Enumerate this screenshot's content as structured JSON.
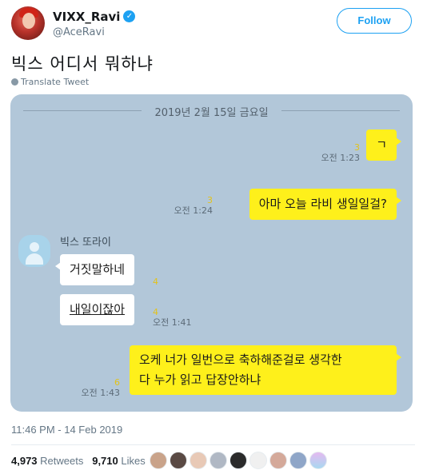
{
  "user": {
    "display_name": "VIXX_Ravi",
    "handle": "@AceRavi",
    "follow_label": "Follow"
  },
  "tweet": {
    "text": "빅스 어디서 뭐하냐",
    "translate_label": "Translate Tweet",
    "timestamp": "11:46 PM - 14 Feb 2019"
  },
  "chat": {
    "date_separator": "2019년 2월 15일 금요일",
    "friend_name": "빅스 또라이",
    "messages": [
      {
        "from": "me",
        "text": "ㄱ",
        "count": "3",
        "time": "오전 1:23"
      },
      {
        "from": "me",
        "text": "아마 오늘 라비 생일일걸?",
        "count": "3",
        "time": "오전 1:24"
      },
      {
        "from": "them",
        "text": "거짓말하네",
        "count": "4",
        "time": ""
      },
      {
        "from": "them",
        "text": "내일이잖아",
        "count": "4",
        "time": "오전 1:41"
      },
      {
        "from": "me",
        "text_line1": "오케 너가 일번으로 축하해준걸로 생각한",
        "text_line2": "다 누가 읽고 답장안하냐",
        "count": "6",
        "time": "오전 1:43"
      }
    ]
  },
  "stats": {
    "retweets_count": "4,973",
    "retweets_label": "Retweets",
    "likes_count": "9,710",
    "likes_label": "Likes"
  },
  "colors": {
    "accent": "#1da1f2",
    "chat_background": "#b2c7d9",
    "my_bubble": "#fef01b",
    "their_bubble": "#ffffff",
    "read_count": "#e2c21a"
  }
}
